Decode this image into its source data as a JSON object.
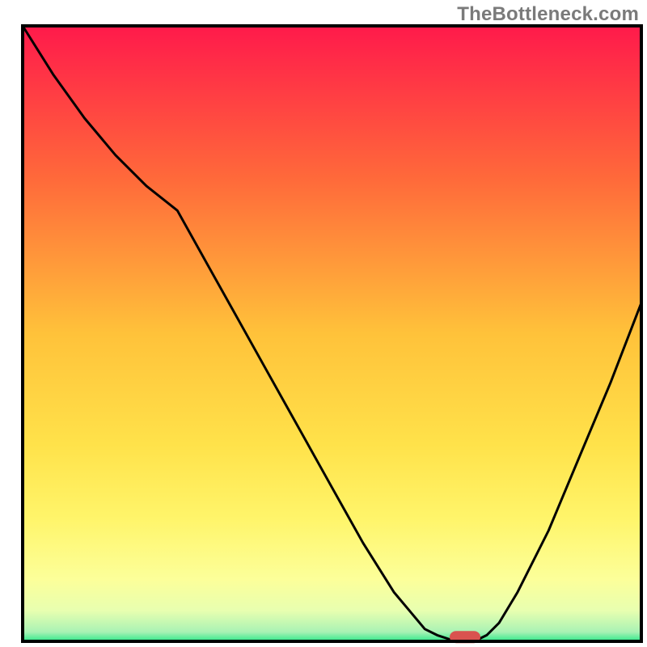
{
  "watermark": "TheBottleneck.com",
  "chart_data": {
    "type": "line",
    "title": "",
    "xlabel": "",
    "ylabel": "",
    "xlim": [
      0,
      100
    ],
    "ylim": [
      0,
      100
    ],
    "grid": false,
    "series": [
      {
        "name": "curve",
        "x": [
          0,
          5,
          10,
          15,
          20,
          25,
          30,
          35,
          40,
          45,
          50,
          55,
          60,
          65,
          67,
          70,
          73,
          75,
          77,
          80,
          85,
          90,
          95,
          100
        ],
        "y": [
          100,
          92,
          85,
          79,
          74,
          70,
          61,
          52,
          43,
          34,
          25,
          16,
          8,
          2,
          1,
          0,
          0,
          1,
          3,
          8,
          18,
          30,
          42,
          55
        ]
      }
    ],
    "marker": {
      "x": 71.5,
      "y": 0.7
    },
    "gradient_stops": [
      {
        "offset": 0.0,
        "color": "#ff1a4b"
      },
      {
        "offset": 0.25,
        "color": "#ff6a3a"
      },
      {
        "offset": 0.5,
        "color": "#ffc23a"
      },
      {
        "offset": 0.68,
        "color": "#ffe24a"
      },
      {
        "offset": 0.8,
        "color": "#fff56a"
      },
      {
        "offset": 0.9,
        "color": "#fcff9a"
      },
      {
        "offset": 0.95,
        "color": "#e8ffb0"
      },
      {
        "offset": 0.985,
        "color": "#a8f2b4"
      },
      {
        "offset": 1.0,
        "color": "#2ee88a"
      }
    ]
  },
  "frame": {
    "stroke": "#000000",
    "width": 4
  },
  "curve_style": {
    "stroke": "#000000",
    "width": 3
  },
  "marker_style": {
    "fill": "#d9534f",
    "rx": 8,
    "w": 38,
    "h": 15
  }
}
